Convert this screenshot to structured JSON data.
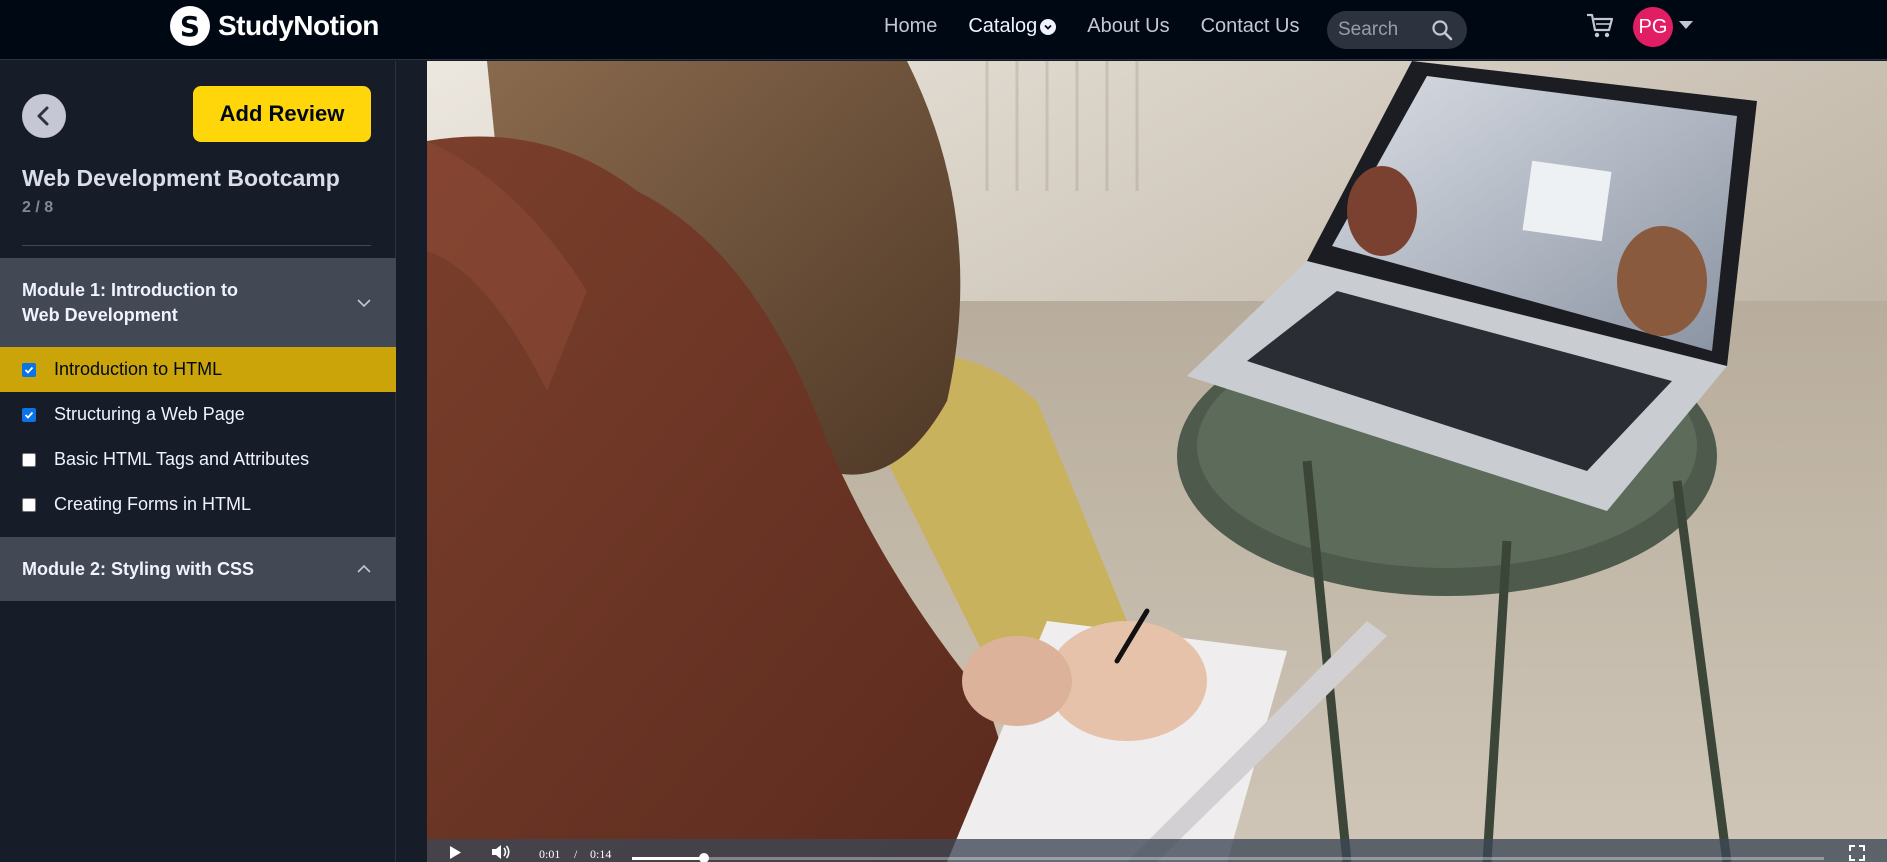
{
  "brand": {
    "name": "StudyNotion",
    "logo_letter": "S"
  },
  "nav": {
    "home": "Home",
    "catalog": "Catalog",
    "about": "About Us",
    "contact": "Contact Us"
  },
  "search": {
    "placeholder": "Search"
  },
  "user": {
    "initials": "PG",
    "avatar_color": "#e11d63"
  },
  "sidebar": {
    "add_review_label": "Add Review",
    "course_title": "Web Development Bootcamp",
    "progress": "2 / 8",
    "modules": [
      {
        "title_line1": "Module 1: Introduction to",
        "title_line2": "Web Development",
        "expanded": true,
        "lectures": [
          {
            "label": "Introduction to HTML",
            "completed": true,
            "active": true
          },
          {
            "label": "Structuring a Web Page",
            "completed": true,
            "active": false
          },
          {
            "label": "Basic HTML Tags and Attributes",
            "completed": false,
            "active": false
          },
          {
            "label": "Creating Forms in HTML",
            "completed": false,
            "active": false
          }
        ]
      },
      {
        "title": "Module 2: Styling with CSS",
        "expanded": false
      }
    ]
  },
  "video": {
    "current_time": "0:01",
    "separator": "/",
    "duration": "0:14",
    "progress_fraction": 0.06
  },
  "colors": {
    "accent_yellow": "#ffd60a",
    "active_lecture_bg": "#caa408",
    "module_header_bg": "#424854",
    "checkbox_checked": "#0b73e6"
  }
}
